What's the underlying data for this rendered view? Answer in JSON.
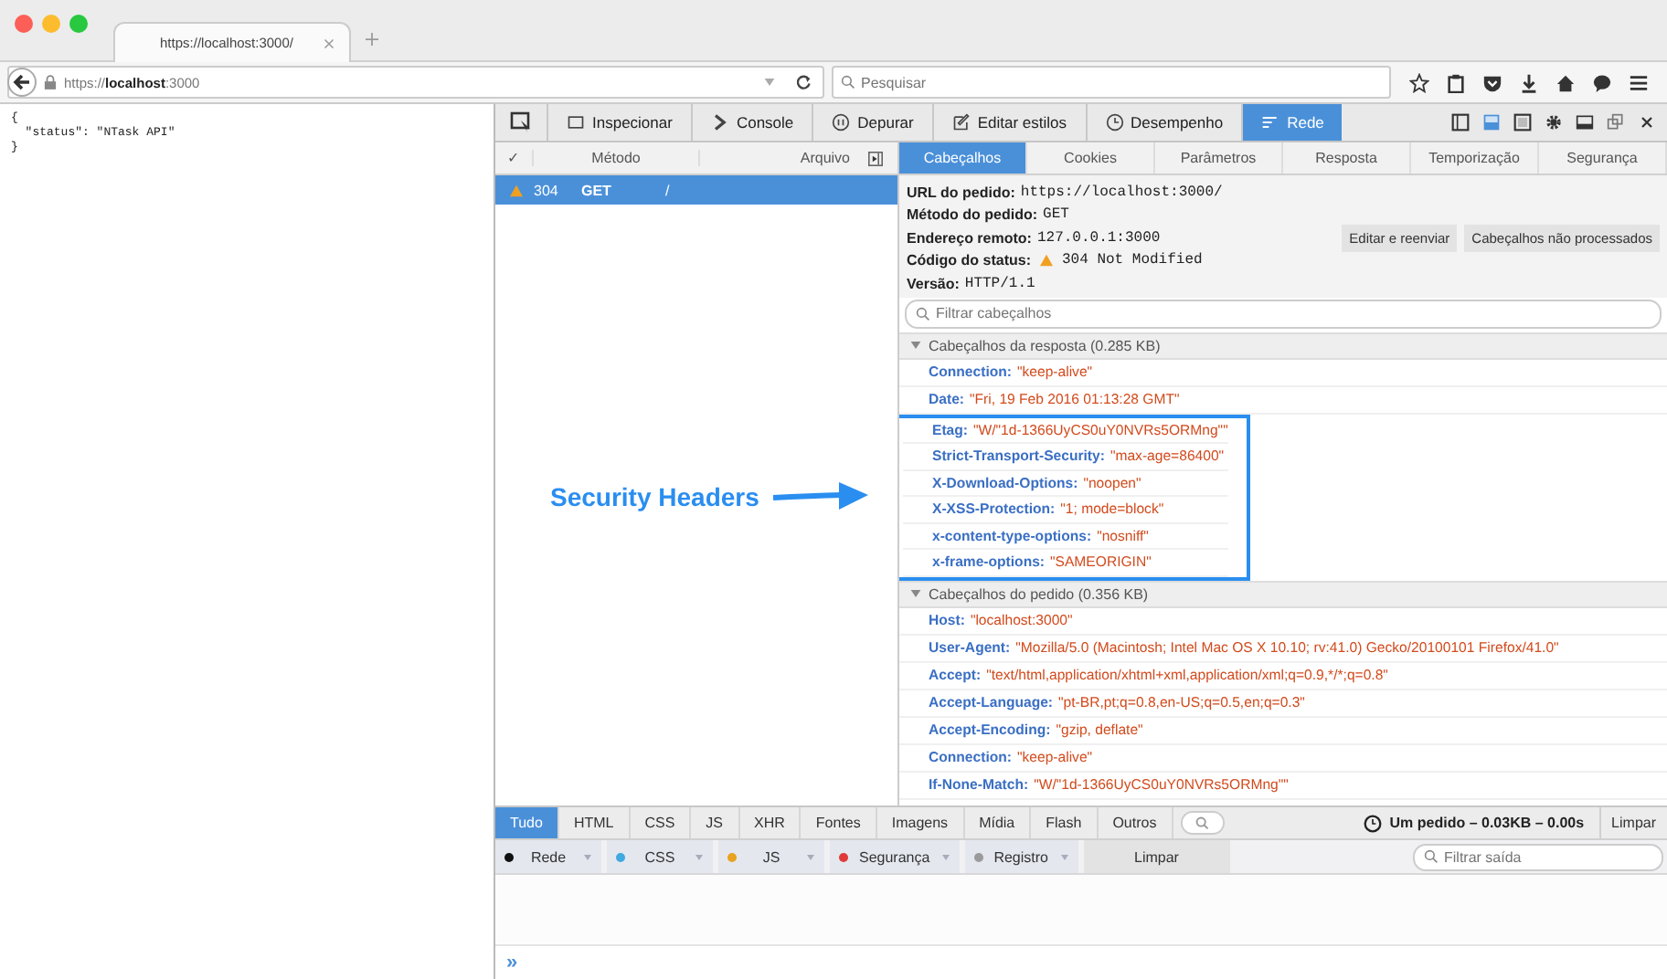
{
  "browser": {
    "tabs": [
      {
        "title": "https://localhost:3000/",
        "selected": true
      }
    ],
    "address": "https://**localhost**:3000",
    "search": {
      "placeholder": "Pesquisar"
    }
  },
  "page_lines": [
    "{",
    "  \"status\": \"NTask API\"",
    "}"
  ],
  "devtools": {
    "tools": [
      {
        "label": "Inspecionar",
        "selected": false
      },
      {
        "label": "Console",
        "selected": false
      },
      {
        "label": "Depurar",
        "selected": false
      },
      {
        "label": "Editar estilos",
        "selected": false
      },
      {
        "label": "Desempenho",
        "selected": false
      },
      {
        "label": "Rede",
        "selected": true
      }
    ],
    "request_list": {
      "columns": [
        "✓",
        "Método",
        "Arquivo"
      ],
      "rows": [
        {
          "status": "304",
          "method": "GET",
          "file": "/",
          "selected": true
        }
      ]
    },
    "detail_tabs": [
      {
        "label": "Cabeçalhos",
        "selected": true
      },
      {
        "label": "Cookies",
        "selected": false
      },
      {
        "label": "Parâmetros",
        "selected": false
      },
      {
        "label": "Resposta",
        "selected": false
      },
      {
        "label": "Temporização",
        "selected": false
      },
      {
        "label": "Segurança",
        "selected": false
      }
    ],
    "summary": [
      {
        "label": "URL do pedido:",
        "value": "https://localhost:3000/",
        "warning": false
      },
      {
        "label": "Método do pedido:",
        "value": "GET",
        "warning": false
      },
      {
        "label": "Endereço remoto:",
        "value": "127.0.0.1:3000",
        "warning": false
      },
      {
        "label": "Código do status:",
        "value": "304 Not Modified",
        "warning": true
      },
      {
        "label": "Versão:",
        "value": "HTTP/1.1",
        "warning": false
      }
    ],
    "buttons": [
      "Editar e reenviar",
      "Cabeçalhos não processados"
    ],
    "filter": {
      "placeholder": "Filtrar cabeçalhos"
    },
    "sections": [
      {
        "title": "Cabeçalhos da resposta (0.285 KB)",
        "expanded": true,
        "headers": [
          {
            "name": "Connection:",
            "value": "\"keep-alive\"",
            "highlighted": false
          },
          {
            "name": "Date:",
            "value": "\"Fri, 19 Feb 2016 01:13:28 GMT\"",
            "highlighted": false
          },
          {
            "name": "Etag:",
            "value": "\"W/\"1d-1366UyCS0uY0NVRs5ORMng\"\"",
            "highlighted": true
          },
          {
            "name": "Strict-Transport-Security:",
            "value": "\"max-age=86400\"",
            "highlighted": true
          },
          {
            "name": "X-Download-Options:",
            "value": "\"noopen\"",
            "highlighted": true
          },
          {
            "name": "X-XSS-Protection:",
            "value": "\"1; mode=block\"",
            "highlighted": true
          },
          {
            "name": "x-content-type-options:",
            "value": "\"nosniff\"",
            "highlighted": true
          },
          {
            "name": "x-frame-options:",
            "value": "\"SAMEORIGIN\"",
            "highlighted": true
          }
        ]
      },
      {
        "title": "Cabeçalhos do pedido (0.356 KB)",
        "expanded": true,
        "headers": [
          {
            "name": "Host:",
            "value": "\"localhost:3000\"",
            "highlighted": false
          },
          {
            "name": "User-Agent:",
            "value": "\"Mozilla/5.0 (Macintosh; Intel Mac OS X 10.10; rv:41.0) Gecko/20100101 Firefox/41.0\"",
            "highlighted": false
          },
          {
            "name": "Accept:",
            "value": "\"text/html,application/xhtml+xml,application/xml;q=0.9,*/*;q=0.8\"",
            "highlighted": false
          },
          {
            "name": "Accept-Language:",
            "value": "\"pt-BR,pt;q=0.8,en-US;q=0.5,en;q=0.3\"",
            "highlighted": false
          },
          {
            "name": "Accept-Encoding:",
            "value": "\"gzip, deflate\"",
            "highlighted": false
          },
          {
            "name": "Connection:",
            "value": "\"keep-alive\"",
            "highlighted": false
          },
          {
            "name": "If-None-Match:",
            "value": "\"W/\"1d-1366UyCS0uY0NVRs5ORMng\"\"",
            "highlighted": false
          }
        ]
      }
    ],
    "annotation": "Security Headers",
    "type_filters": [
      {
        "label": "Tudo",
        "selected": true
      },
      {
        "label": "HTML",
        "selected": false
      },
      {
        "label": "CSS",
        "selected": false
      },
      {
        "label": "JS",
        "selected": false
      },
      {
        "label": "XHR",
        "selected": false
      },
      {
        "label": "Fontes",
        "selected": false
      },
      {
        "label": "Imagens",
        "selected": false
      },
      {
        "label": "Mídia",
        "selected": false
      },
      {
        "label": "Flash",
        "selected": false
      },
      {
        "label": "Outros",
        "selected": false
      }
    ],
    "network_summary": "Um pedido – 0.03KB – 0.00s",
    "clear_button": "Limpar",
    "console_filters": [
      {
        "label": "Rede",
        "color": "#111111"
      },
      {
        "label": "CSS",
        "color": "#3fa9e0"
      },
      {
        "label": "JS",
        "color": "#e8a21f"
      },
      {
        "label": "Segurança",
        "color": "#e0393a"
      },
      {
        "label": "Registro",
        "color": "#9a9a9a"
      }
    ],
    "console_clear": "Limpar",
    "console_filter": {
      "placeholder": "Filtrar saída"
    },
    "prompt": "»"
  }
}
